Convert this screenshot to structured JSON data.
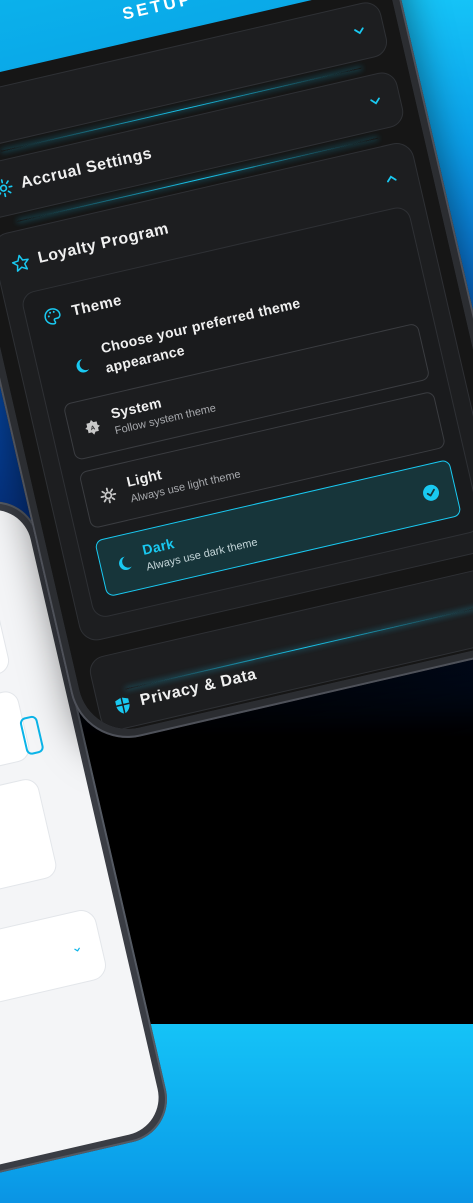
{
  "header": {
    "title": "SETUP"
  },
  "sections": [
    {
      "label": "",
      "icon": "chevron-down-icon"
    },
    {
      "label": "Accrual Settings",
      "icon": "gear-icon"
    },
    {
      "label": "Loyalty Program",
      "icon": "star-icon"
    }
  ],
  "theme": {
    "title": "Theme",
    "prompt": "Choose your preferred theme appearance",
    "options": [
      {
        "title": "System",
        "subtitle": "Follow system theme",
        "icon": "auto-brightness-icon",
        "selected": false
      },
      {
        "title": "Light",
        "subtitle": "Always use light theme",
        "icon": "sun-gear-icon",
        "selected": false
      },
      {
        "title": "Dark",
        "subtitle": "Always use dark theme",
        "icon": "moon-icon",
        "selected": true
      }
    ]
  },
  "privacy": {
    "label": "Privacy & Data",
    "icon": "shield-icon"
  },
  "colors": {
    "accent": "#19c9f1",
    "background": "#161616",
    "card": "#1d1e20"
  }
}
